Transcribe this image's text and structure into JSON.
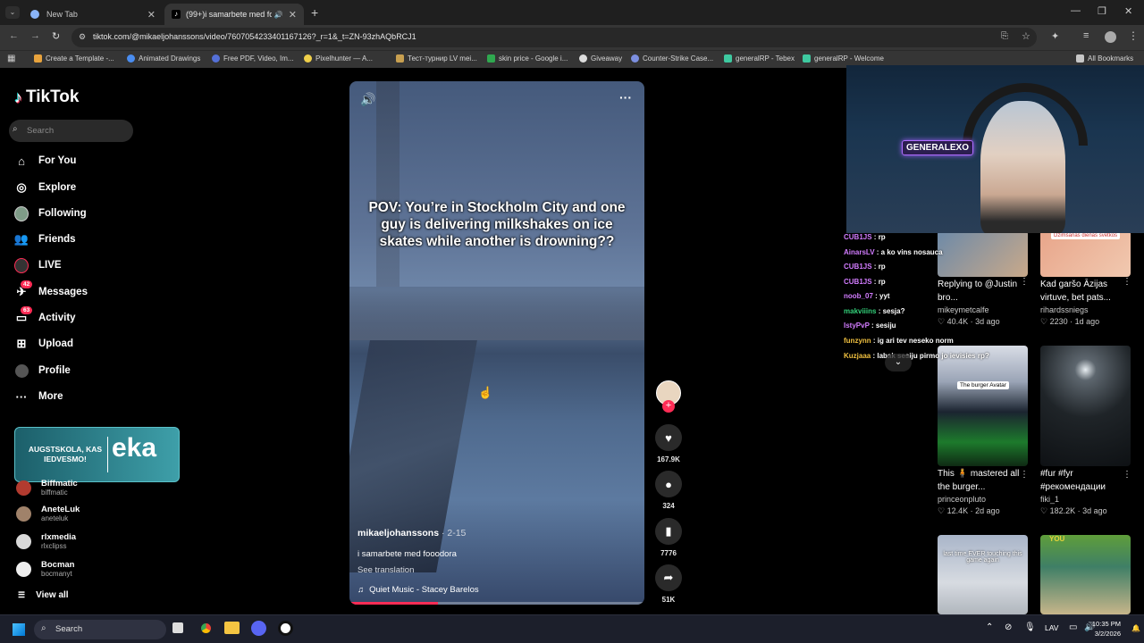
{
  "browser": {
    "tabs": [
      {
        "title": "New Tab",
        "active": false
      },
      {
        "title": "(99+)i samarbete med fooo",
        "active": true
      }
    ],
    "url": "tiktok.com/@mikaeljohanssons/video/7607054233401167126?_r=1&_t=ZN-93zhAQbRCJ1",
    "bookmarks": [
      "Create a Template -...",
      "Animated Drawings",
      "Free PDF, Video, Im...",
      "Pixelhunter — A...",
      "Тест-турнир LV mei...",
      "skin price - Google i...",
      "Giveaway",
      "Counter-Strike Case...",
      "generalRP - Tebex",
      "generalRP - Welcome"
    ],
    "all_bookmarks": "All Bookmarks"
  },
  "sidebar": {
    "logo": "TikTok",
    "search_placeholder": "Search",
    "nav": [
      {
        "label": "For You",
        "icon": "home-icon"
      },
      {
        "label": "Explore",
        "icon": "compass-icon"
      },
      {
        "label": "Following",
        "icon": "following-avatar-icon"
      },
      {
        "label": "Friends",
        "icon": "friends-icon"
      },
      {
        "label": "LIVE",
        "icon": "live-icon"
      },
      {
        "label": "Messages",
        "icon": "messages-icon",
        "badge": "42"
      },
      {
        "label": "Activity",
        "icon": "activity-icon",
        "badge": "63"
      },
      {
        "label": "Upload",
        "icon": "upload-icon"
      },
      {
        "label": "Profile",
        "icon": "profile-icon"
      },
      {
        "label": "More",
        "icon": "more-icon"
      }
    ],
    "overlay_text_small": "AUGSTSKOLA, KAS IEDVESMO!",
    "overlay_text_big": "eka",
    "following_accounts": [
      {
        "name": "Biffmatic",
        "handle": "biffmatic"
      },
      {
        "name": "AneteLuk",
        "handle": "aneteluk"
      },
      {
        "name": "rlxmedia",
        "handle": "rlxclipss"
      },
      {
        "name": "Bocman",
        "handle": "bocmanyt"
      }
    ],
    "view_all": "View all"
  },
  "video": {
    "caption": "POV: You’re in Stockholm City and one guy is delivering milkshakes on ice skates while another is drowning??",
    "author": "mikaeljohanssons",
    "date": " · 2-15",
    "description": "i samarbete med fooodora",
    "see_translation": "See translation",
    "music": "Quiet Music - Stacey Barelos",
    "progress": 0.3
  },
  "actions": {
    "likes": "167.9K",
    "comments": "324",
    "saves": "7776",
    "shares": "51K"
  },
  "stream_overlay": {
    "chat": [
      {
        "user": "CUB1JS",
        "msg": "rp",
        "color": "#d27cff"
      },
      {
        "user": "AinarsLV",
        "msg": "a ko vins nosauca",
        "color": "#d27cff"
      },
      {
        "user": "CUB1JS",
        "msg": "rp",
        "color": "#d27cff"
      },
      {
        "user": "CUB1JS",
        "msg": "rp",
        "color": "#d27cff"
      },
      {
        "user": "noob_07",
        "msg": "yyt",
        "color": "#d27cff"
      },
      {
        "user": "makviiins",
        "msg": "sesja?",
        "color": "#33d17a"
      },
      {
        "user": "IstyPvP",
        "msg": "sesiju",
        "color": "#d27cff"
      },
      {
        "user": "funzynn",
        "msg": "ig ari tev neseko norm",
        "color": "#f0c040"
      },
      {
        "user": "Kuzjaaa",
        "msg": "labak sesiju pirmo jo ievisies rp?",
        "color": "#f0c040"
      }
    ],
    "cam_label": "GENERALEXO"
  },
  "recommended": [
    {
      "title": "Replying to @Justin bro...",
      "author": "mikeymetcalfe",
      "likes": "40.4K",
      "age": "3d ago",
      "thumb_text": ""
    },
    {
      "title": "Kad garšo Āzijas virtuve, bet pats...",
      "author": "rihardssniegs",
      "likes": "2230",
      "age": "1d ago",
      "thumb_text": "Dzimšanas dienas svētkos"
    },
    {
      "title": "This 🧍 mastered all the burger...",
      "author": "princeonpluto",
      "likes": "12.4K",
      "age": "2d ago",
      "thumb_text": "The burger Avatar"
    },
    {
      "title": "#fur #fyr #рекомендации",
      "author": "fiki_1",
      "likes": "182.2K",
      "age": "3d ago",
      "thumb_text": ""
    },
    {
      "title": "",
      "author": "",
      "likes": "",
      "age": "",
      "thumb_text": "last time EVER touching this game again"
    },
    {
      "title": "",
      "author": "",
      "likes": "",
      "age": "",
      "thumb_text": "YOU"
    }
  ],
  "taskbar": {
    "search": "Search",
    "lang": "LAV",
    "time": "10:35 PM",
    "date": "3/2/2026"
  }
}
